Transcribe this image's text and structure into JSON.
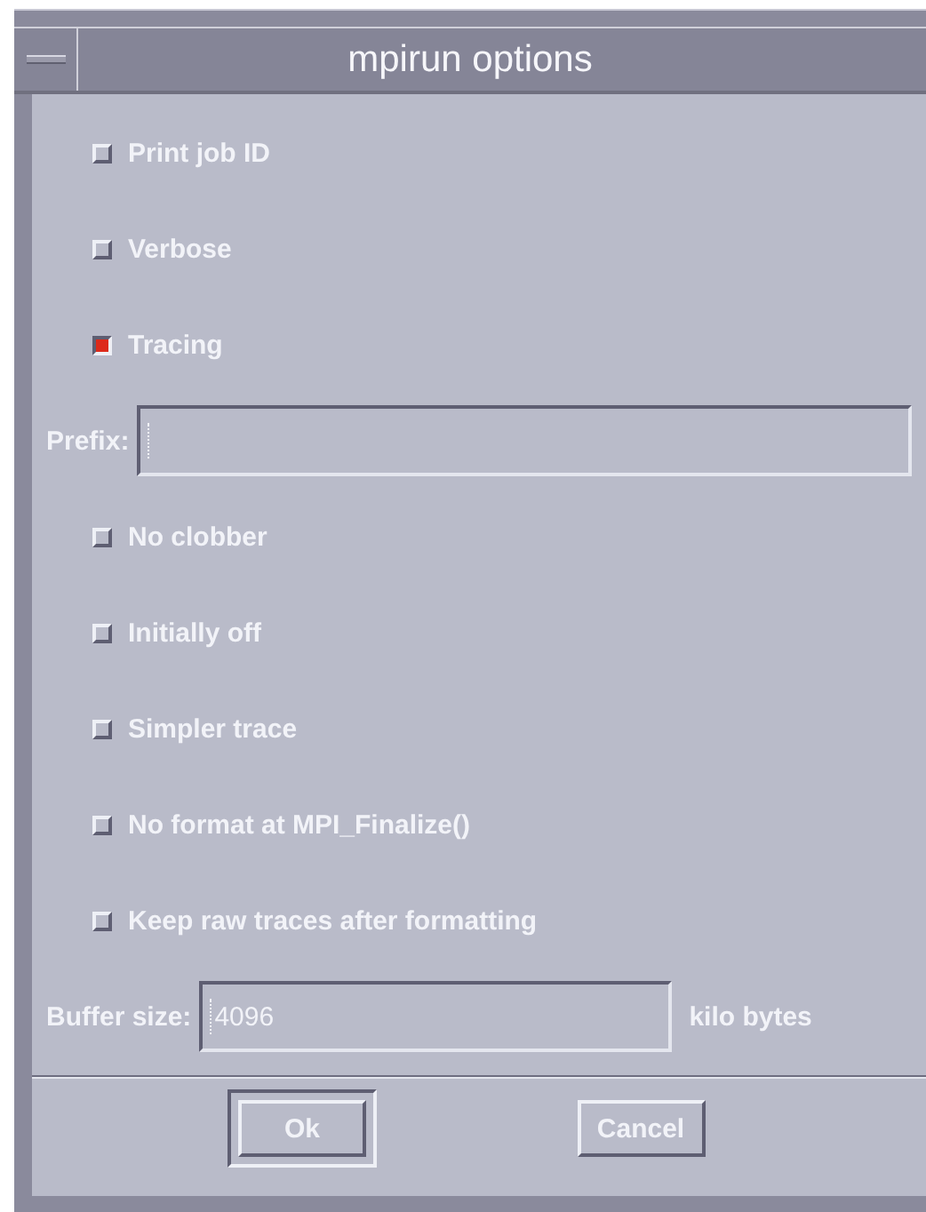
{
  "window": {
    "title": "mpirun options"
  },
  "items": [
    {
      "kind": "checkbox",
      "label": "Print job ID",
      "checked": false
    },
    {
      "kind": "checkbox",
      "label": "Verbose",
      "checked": false
    },
    {
      "kind": "checkbox",
      "label": "Tracing",
      "checked": true
    },
    {
      "kind": "field",
      "label": "Prefix:"
    },
    {
      "kind": "checkbox",
      "label": "No clobber",
      "checked": false
    },
    {
      "kind": "checkbox",
      "label": "Initially off",
      "checked": false
    },
    {
      "kind": "checkbox",
      "label": "Simpler trace",
      "checked": false
    },
    {
      "kind": "checkbox",
      "label": "No format at MPI_Finalize()",
      "checked": false
    },
    {
      "kind": "checkbox",
      "label": "Keep raw traces after formatting",
      "checked": false
    },
    {
      "kind": "field",
      "label": "Buffer size:",
      "value": "4096",
      "suffix": "kilo bytes"
    }
  ],
  "buttons": [
    {
      "label": "Ok",
      "default": true
    },
    {
      "label": "Cancel",
      "default": false
    }
  ]
}
